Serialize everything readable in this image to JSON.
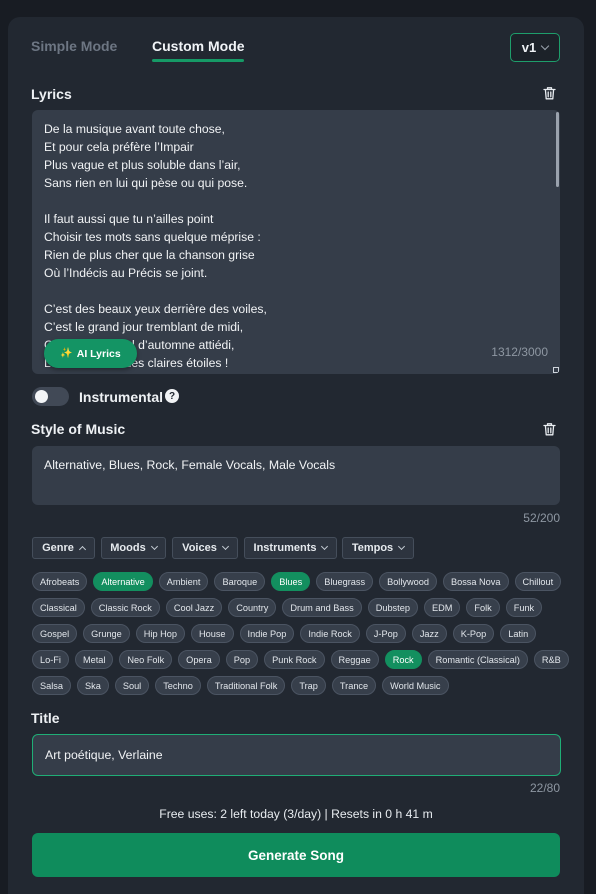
{
  "modes": {
    "simple_label": "Simple Mode",
    "custom_label": "Custom Mode",
    "active": "Custom Mode"
  },
  "version": {
    "selected": "v1"
  },
  "lyrics": {
    "label": "Lyrics",
    "stanzas": [
      [
        "De la musique avant toute chose,",
        "Et pour cela préfère l’Impair",
        "Plus vague et plus soluble dans l’air,",
        "Sans rien en lui qui pèse ou qui pose."
      ],
      [
        "Il faut aussi que tu n’ailles point",
        "Choisir tes mots sans quelque méprise :",
        "Rien de plus cher que la chanson grise",
        "Où l’Indécis au Précis se joint."
      ],
      [
        "C’est des beaux yeux derrière des voiles,",
        "C’est le grand jour tremblant de midi,",
        "C’est, par un ciel d’automne attiédi,",
        "Le bleu fouillis des claires étoiles !"
      ]
    ],
    "char_count": "1312/3000",
    "ai_button_label": "AI Lyrics"
  },
  "instrumental": {
    "label": "Instrumental",
    "enabled": false
  },
  "style": {
    "label": "Style of Music",
    "value": "Alternative, Blues, Rock, Female Vocals, Male Vocals",
    "char_count": "52/200"
  },
  "filters": [
    {
      "label": "Genre",
      "expanded": true
    },
    {
      "label": "Moods",
      "expanded": false
    },
    {
      "label": "Voices",
      "expanded": false
    },
    {
      "label": "Instruments",
      "expanded": false
    },
    {
      "label": "Tempos",
      "expanded": false
    }
  ],
  "genre_tags": [
    {
      "label": "Afrobeats",
      "selected": false
    },
    {
      "label": "Alternative",
      "selected": true
    },
    {
      "label": "Ambient",
      "selected": false
    },
    {
      "label": "Baroque",
      "selected": false
    },
    {
      "label": "Blues",
      "selected": true
    },
    {
      "label": "Bluegrass",
      "selected": false
    },
    {
      "label": "Bollywood",
      "selected": false
    },
    {
      "label": "Bossa Nova",
      "selected": false
    },
    {
      "label": "Chillout",
      "selected": false
    },
    {
      "label": "Classical",
      "selected": false
    },
    {
      "label": "Classic Rock",
      "selected": false
    },
    {
      "label": "Cool Jazz",
      "selected": false
    },
    {
      "label": "Country",
      "selected": false
    },
    {
      "label": "Drum and Bass",
      "selected": false
    },
    {
      "label": "Dubstep",
      "selected": false
    },
    {
      "label": "EDM",
      "selected": false
    },
    {
      "label": "Folk",
      "selected": false
    },
    {
      "label": "Funk",
      "selected": false
    },
    {
      "label": "Gospel",
      "selected": false
    },
    {
      "label": "Grunge",
      "selected": false
    },
    {
      "label": "Hip Hop",
      "selected": false
    },
    {
      "label": "House",
      "selected": false
    },
    {
      "label": "Indie Pop",
      "selected": false
    },
    {
      "label": "Indie Rock",
      "selected": false
    },
    {
      "label": "J-Pop",
      "selected": false
    },
    {
      "label": "Jazz",
      "selected": false
    },
    {
      "label": "K-Pop",
      "selected": false
    },
    {
      "label": "Latin",
      "selected": false
    },
    {
      "label": "Lo-Fi",
      "selected": false
    },
    {
      "label": "Metal",
      "selected": false
    },
    {
      "label": "Neo Folk",
      "selected": false
    },
    {
      "label": "Opera",
      "selected": false
    },
    {
      "label": "Pop",
      "selected": false
    },
    {
      "label": "Punk Rock",
      "selected": false
    },
    {
      "label": "Reggae",
      "selected": false
    },
    {
      "label": "Rock",
      "selected": true
    },
    {
      "label": "Romantic (Classical)",
      "selected": false
    },
    {
      "label": "R&B",
      "selected": false
    },
    {
      "label": "Salsa",
      "selected": false
    },
    {
      "label": "Ska",
      "selected": false
    },
    {
      "label": "Soul",
      "selected": false
    },
    {
      "label": "Techno",
      "selected": false
    },
    {
      "label": "Traditional Folk",
      "selected": false
    },
    {
      "label": "Trap",
      "selected": false
    },
    {
      "label": "Trance",
      "selected": false
    },
    {
      "label": "World Music",
      "selected": false
    }
  ],
  "title": {
    "label": "Title",
    "value": "Art poétique, Verlaine",
    "char_count": "22/80"
  },
  "usage": {
    "text": "Free uses: 2 left today (3/day) | Resets in 0 h 41 m"
  },
  "generate_label": "Generate Song",
  "colors": {
    "accent": "#149464",
    "background": "#181c23",
    "panel": "#222831",
    "field": "#353d49"
  },
  "icons": {
    "trash": "trash-icon",
    "chevron": "chevron-down-icon",
    "help": "question-circle-icon",
    "sparkles": "sparkles-icon"
  }
}
